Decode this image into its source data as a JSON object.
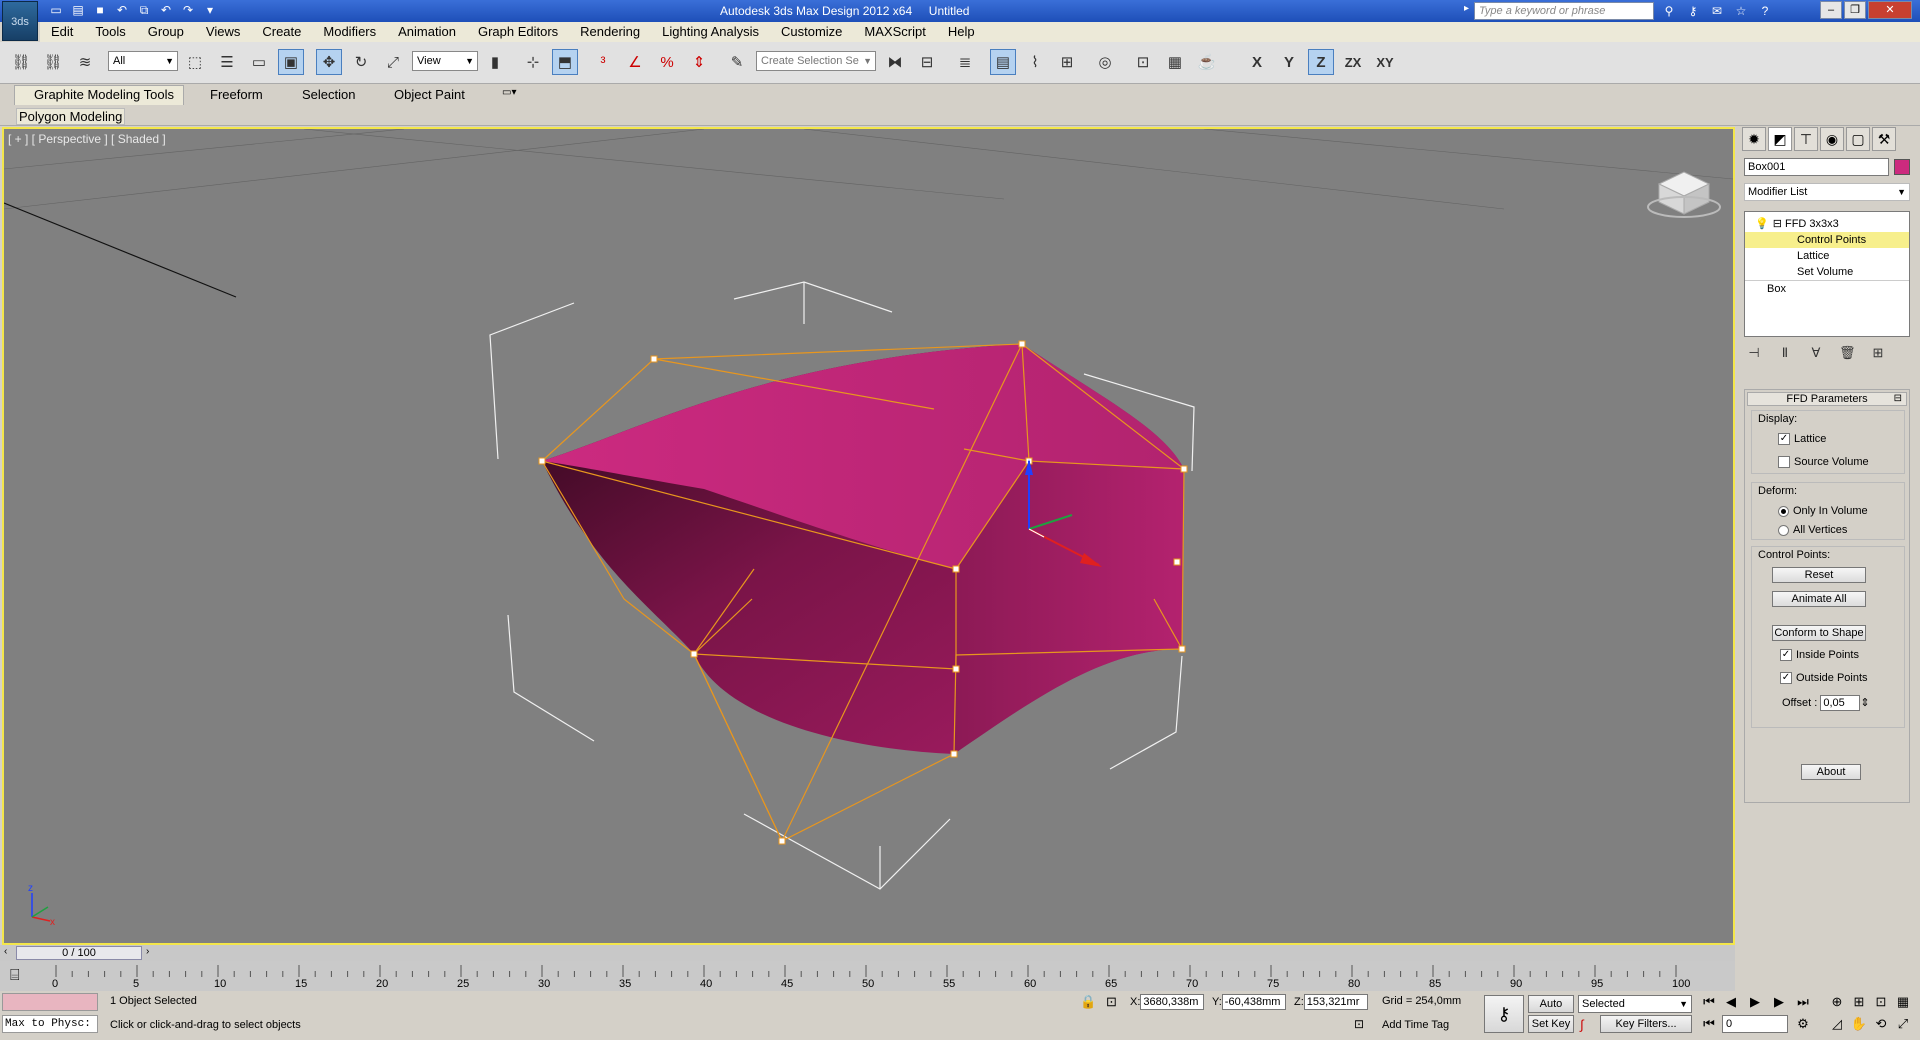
{
  "app": {
    "title": "Autodesk 3ds Max Design 2012 x64     Untitled",
    "logo_text": "3ds"
  },
  "search": {
    "placeholder": "Type a keyword or phrase"
  },
  "menu": [
    "Edit",
    "Tools",
    "Group",
    "Views",
    "Create",
    "Modifiers",
    "Animation",
    "Graph Editors",
    "Rendering",
    "Lighting Analysis",
    "Customize",
    "MAXScript",
    "Help"
  ],
  "toolbar": {
    "filter": "All",
    "ref_coord": "View",
    "selection_set": "Create Selection Se",
    "axes": [
      "X",
      "Y",
      "Z",
      "ZX",
      "XY"
    ]
  },
  "ribbon": {
    "tabs": [
      "Graphite Modeling Tools",
      "Freeform",
      "Selection",
      "Object Paint"
    ],
    "panel": "Polygon Modeling"
  },
  "viewport": {
    "label": "[ + ] [ Perspective ] [ Shaded ]",
    "object_color": "#b8287a",
    "lattice_color": "#e8961e",
    "border_color": "#f3e64a"
  },
  "command_panel": {
    "object_name": "Box001",
    "object_color": "#cc2a7e",
    "modifier_list": "Modifier List",
    "stack": {
      "modifier": "FFD 3x3x3",
      "subobjects": [
        "Control Points",
        "Lattice",
        "Set Volume"
      ],
      "base": "Box",
      "selected": "Control Points"
    },
    "ffd": {
      "title": "FFD Parameters",
      "display_label": "Display:",
      "lattice": {
        "label": "Lattice",
        "checked": true
      },
      "source_volume": {
        "label": "Source Volume",
        "checked": false
      },
      "deform_label": "Deform:",
      "only_in_volume": "Only In Volume",
      "all_vertices": "All Vertices",
      "cp_label": "Control Points:",
      "reset": "Reset",
      "animate_all": "Animate All",
      "conform": "Conform to Shape",
      "inside_points": "Inside Points",
      "outside_points": "Outside Points",
      "offset_label": "Offset :",
      "offset": "0,05",
      "about": "About"
    }
  },
  "timeslider": {
    "value": "0 / 100"
  },
  "trackbar": {
    "labels": [
      "0",
      "5",
      "10",
      "15",
      "20",
      "25",
      "30",
      "35",
      "40",
      "45",
      "50",
      "55",
      "60",
      "65",
      "70",
      "75",
      "80",
      "85",
      "90",
      "95",
      "100"
    ]
  },
  "status": {
    "listener": "Max to Physc:",
    "selected": "1 Object Selected",
    "prompt": "Click or click-and-drag to select objects",
    "x_label": "X:",
    "x": "3680,338m",
    "y_label": "Y:",
    "y": "-60,438mm",
    "z_label": "Z:",
    "z": "153,321mr",
    "grid": "Grid = 254,0mm",
    "add_time_tag": "Add Time Tag",
    "auto_key": "Auto Key",
    "set_key": "Set Key",
    "selected_dropdown": "Selected",
    "key_filters": "Key Filters...",
    "frame": "0"
  }
}
